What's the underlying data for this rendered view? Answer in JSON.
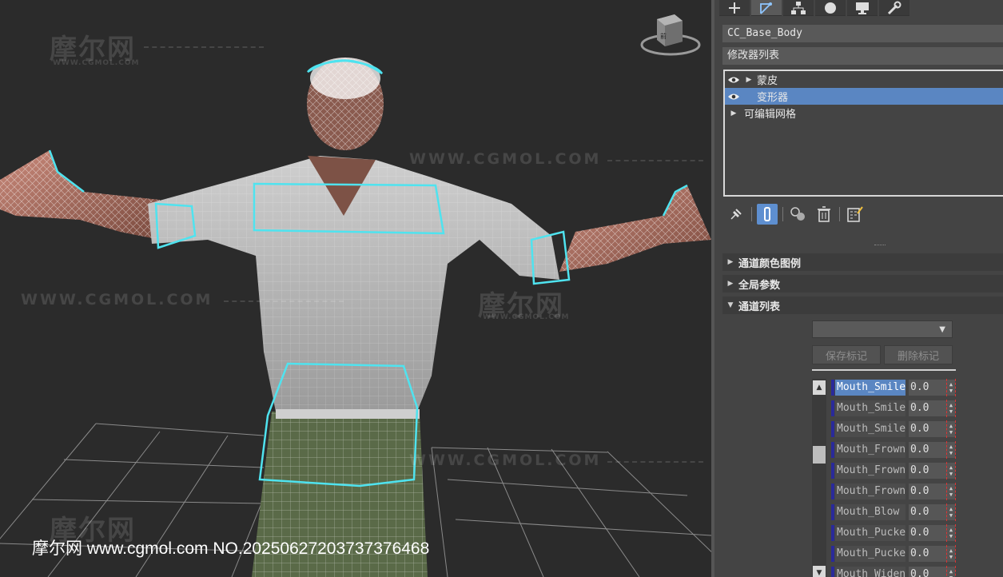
{
  "viewport": {
    "watermarks": {
      "brand": "摩尔网",
      "domain_small": "WWW.CGMOL.COM",
      "url": "WWW.CGMOL.COM"
    },
    "caption": "摩尔网 www.cgmol.com NO.20250627203737376468",
    "viewcube_label": "前"
  },
  "panel": {
    "tabs": [
      "create-icon",
      "modify-icon",
      "hierarchy-icon",
      "motion-icon",
      "display-icon",
      "utilities-icon"
    ],
    "active_tab": 1,
    "object_name": "CC_Base_Body",
    "modifier_list_label": "修改器列表",
    "stack": [
      {
        "label": "蒙皮",
        "has_eye": true,
        "expandable": true,
        "selected": false
      },
      {
        "label": "变形器",
        "has_eye": true,
        "expandable": false,
        "selected": true
      },
      {
        "label": "可编辑网格",
        "has_eye": false,
        "expandable": true,
        "selected": false
      }
    ],
    "stack_tools": [
      "pin-stack-icon",
      "show-end-result-icon",
      "make-unique-icon",
      "remove-modifier-icon",
      "configure-modifier-sets-icon"
    ],
    "rollouts": [
      {
        "label": "通道颜色图例",
        "expanded": false
      },
      {
        "label": "全局参数",
        "expanded": false
      },
      {
        "label": "通道列表",
        "expanded": true
      }
    ],
    "channel_select_value": "",
    "save_marker_label": "保存标记",
    "delete_marker_label": "删除标记",
    "channels": [
      {
        "name": "Mouth_Smile",
        "value": "0.0",
        "selected": true
      },
      {
        "name": "Mouth_Smile",
        "value": "0.0",
        "selected": false
      },
      {
        "name": "Mouth_Smile",
        "value": "0.0",
        "selected": false
      },
      {
        "name": "Mouth_Frown",
        "value": "0.0",
        "selected": false
      },
      {
        "name": "Mouth_Frown",
        "value": "0.0",
        "selected": false
      },
      {
        "name": "Mouth_Frown",
        "value": "0.0",
        "selected": false
      },
      {
        "name": "Mouth_Blow",
        "value": "0.0",
        "selected": false
      },
      {
        "name": "Mouth_Pucke",
        "value": "0.0",
        "selected": false
      },
      {
        "name": "Mouth_Pucke",
        "value": "0.0",
        "selected": false
      },
      {
        "name": "Mouth_Widen",
        "value": "0.0",
        "selected": false
      }
    ],
    "colors": {
      "selection": "#5a86c2",
      "panel_bg": "#444444",
      "channel_marker": "#2a2a9a",
      "highlight_outline": "#4fe3ef"
    }
  }
}
